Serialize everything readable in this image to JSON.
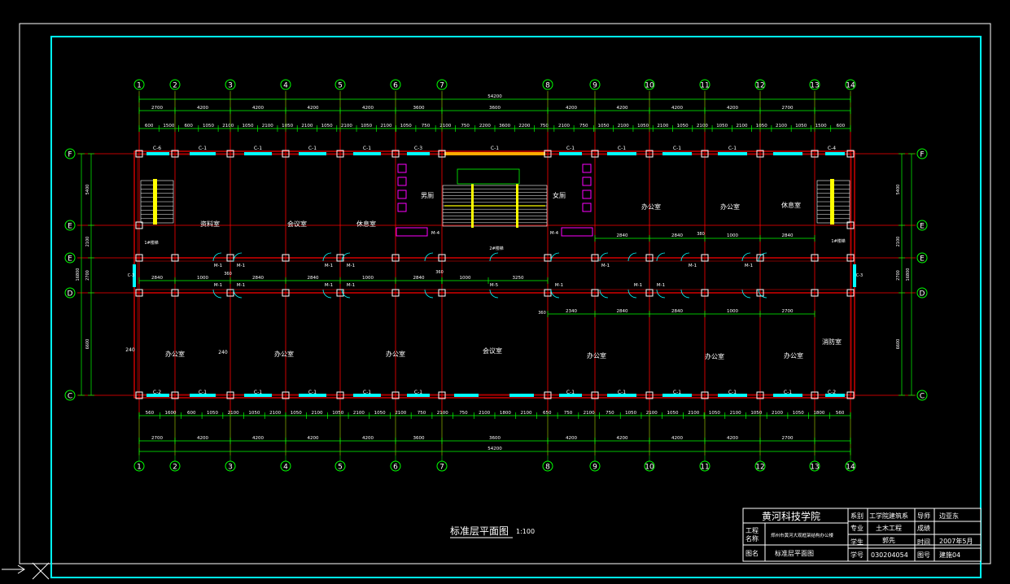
{
  "grid_columns": [
    "1",
    "2",
    "3",
    "4",
    "5",
    "6",
    "7",
    "8",
    "9",
    "10",
    "11",
    "12",
    "13",
    "14"
  ],
  "grid_rows": [
    "F",
    "1∕E",
    "E",
    "D",
    "C"
  ],
  "dims": {
    "total": "54200",
    "bays": [
      "2700",
      "4200",
      "4200",
      "4200",
      "4200",
      "3600",
      "",
      "3600",
      "4200",
      "4200",
      "4200",
      "4200",
      "2700"
    ],
    "top_detail": [
      "600",
      "1500",
      "600",
      "1050",
      "2100",
      "1050",
      "2100",
      "1050",
      "2100",
      "1050",
      "2100",
      "1050",
      "2100",
      "1050",
      "750",
      "2100",
      "750",
      "2200",
      "3600",
      "2200",
      "750",
      "2100",
      "750",
      "1050",
      "2100",
      "1050",
      "2100",
      "1050",
      "2100",
      "1050",
      "2100",
      "1050",
      "2100",
      "1050",
      "1500",
      "600"
    ],
    "bottom_detail": [
      "560",
      "1600",
      "600",
      "1050",
      "2100",
      "1050",
      "2100",
      "1050",
      "2100",
      "1050",
      "2100",
      "1050",
      "2100",
      "750",
      "2100",
      "750",
      "2100",
      "1800",
      "2100",
      "650",
      "750",
      "2100",
      "750",
      "1050",
      "2100",
      "1050",
      "2100",
      "1050",
      "2100",
      "1050",
      "2100",
      "1050",
      "1800",
      "560"
    ],
    "bottom_total": "54200",
    "left_vert": [
      "5400",
      "2100",
      "2700",
      "6600"
    ],
    "left_total": "16800"
  },
  "rooms": {
    "r1": "资料室",
    "r2": "会议室",
    "r3": "休息室",
    "r4": "男厕",
    "r5": "女厕",
    "r6": "办公室",
    "r7": "办公室",
    "r8": "休息室",
    "b1": "办公室",
    "b2": "办公室",
    "b3": "办公室",
    "b4": "会议室",
    "b5": "办公室",
    "b6": "办公室",
    "b7": "办公室",
    "b8": "消防室",
    "stair_left": "1#楼梯",
    "stair_mid": "2#楼梯",
    "stair_right": "1#楼梯"
  },
  "window_labels": {
    "top": [
      "C-6",
      "C-1",
      "C-1",
      "C-1",
      "C-1",
      "C-3",
      "C-1",
      "C-1",
      "C-1",
      "C-1",
      "C-1",
      "C-4"
    ],
    "bottom": [
      "C-2",
      "C-1",
      "C-1",
      "C-1",
      "C-1",
      "C-1",
      "C-1",
      "C-1",
      "C-1",
      "C-1",
      "C-1",
      "C-2"
    ],
    "side": [
      "C-3",
      "C-3"
    ]
  },
  "door_labels": [
    "M-4",
    "M-4",
    "M-1",
    "M-1",
    "M-1",
    "M-1",
    "M-1",
    "M-1",
    "M-1",
    "M-1",
    "M-5",
    "M-1",
    "M-1",
    "M-1",
    "M-1",
    "M-1",
    "M-1"
  ],
  "misc_labels": {
    "wall1": "240",
    "wall2": "240",
    "w360a": "360",
    "w360b": "360",
    "w360c": "360",
    "w380": "380"
  },
  "drawing_title": "标准层平面图",
  "drawing_scale": "1:100",
  "titleblock": {
    "school": "黄河科技学院",
    "dept_label": "系别",
    "dept": "工学院建筑系",
    "advisor_label": "导师",
    "advisor": "边亚东",
    "project_label": "工程\n名称",
    "project_label_1": "工程",
    "project_label_2": "名称",
    "project": "郑州市黄河大观框架结构办公楼",
    "major_label": "专业",
    "major": "土木工程",
    "grade_label": "成绩",
    "grade": "",
    "student_label": "学生",
    "student": "郭先",
    "time_label": "时间",
    "time": "2007年5月",
    "drawing_name_label": "图名",
    "drawing_name": "标准层平面图",
    "id_label": "学号",
    "id": "030204054",
    "sheet_label": "图号",
    "sheet": "建施04"
  },
  "colors": {
    "frame": "#ffffff",
    "border": "#00ffff",
    "dimension": "#00ff00",
    "axis": "#ff0000",
    "wall": "#ff0000",
    "column": "#ffffff",
    "window": "#00ffff",
    "stair": "#ffff00",
    "fixture": "#ff00ff",
    "label": "#ffffff"
  }
}
